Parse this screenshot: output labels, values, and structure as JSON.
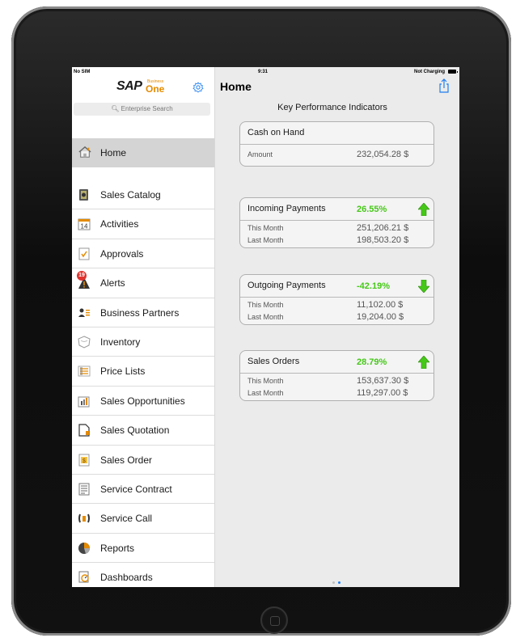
{
  "status": {
    "carrier": "No SIM",
    "time": "9:31",
    "charging": "Not Charging"
  },
  "brand": {
    "sap": "SAP",
    "business": "Business",
    "one": "One"
  },
  "search": {
    "placeholder": "Enterprise Search"
  },
  "sidebar": {
    "home": "Home",
    "items": [
      {
        "label": "Sales Catalog",
        "icon": "catalog-icon"
      },
      {
        "label": "Activities",
        "icon": "calendar-icon",
        "icon_text": "14"
      },
      {
        "label": "Approvals",
        "icon": "checklist-icon"
      },
      {
        "label": "Alerts",
        "icon": "alert-icon",
        "badge": "19"
      },
      {
        "label": "Business Partners",
        "icon": "people-icon"
      },
      {
        "label": "Inventory",
        "icon": "box-icon"
      },
      {
        "label": "Price Lists",
        "icon": "price-list-icon"
      },
      {
        "label": "Sales Opportunities",
        "icon": "opportunity-icon"
      },
      {
        "label": "Sales Quotation",
        "icon": "quotation-icon"
      },
      {
        "label": "Sales Order",
        "icon": "sales-order-icon"
      },
      {
        "label": "Service Contract",
        "icon": "contract-icon"
      },
      {
        "label": "Service Call",
        "icon": "phone-icon"
      },
      {
        "label": "Reports",
        "icon": "pie-chart-icon"
      },
      {
        "label": "Dashboards",
        "icon": "dashboard-icon"
      }
    ]
  },
  "main": {
    "title": "Home",
    "kpi_heading": "Key Performance Indicators",
    "cards": [
      {
        "name": "Cash on Hand",
        "pct": "",
        "trend": "none",
        "rows": [
          {
            "k": "Amount",
            "v": "232,054.28 $"
          }
        ]
      },
      {
        "name": "Incoming Payments",
        "pct": "26.55%",
        "trend": "up",
        "rows": [
          {
            "k": "This Month",
            "v": "251,206.21 $"
          },
          {
            "k": "Last Month",
            "v": "198,503.20 $"
          }
        ]
      },
      {
        "name": "Outgoing Payments",
        "pct": "-42.19%",
        "trend": "down",
        "rows": [
          {
            "k": "This Month",
            "v": "11,102.00 $"
          },
          {
            "k": "Last Month",
            "v": "19,204.00 $"
          }
        ]
      },
      {
        "name": "Sales Orders",
        "pct": "28.79%",
        "trend": "up",
        "rows": [
          {
            "k": "This Month",
            "v": "153,637.30 $"
          },
          {
            "k": "Last Month",
            "v": "119,297.00 $"
          }
        ]
      }
    ]
  },
  "colors": {
    "green": "#46c818",
    "accent": "#1e7ef0",
    "sap_orange": "#e48b00"
  },
  "pager": {
    "pages": 2,
    "current": 2
  }
}
